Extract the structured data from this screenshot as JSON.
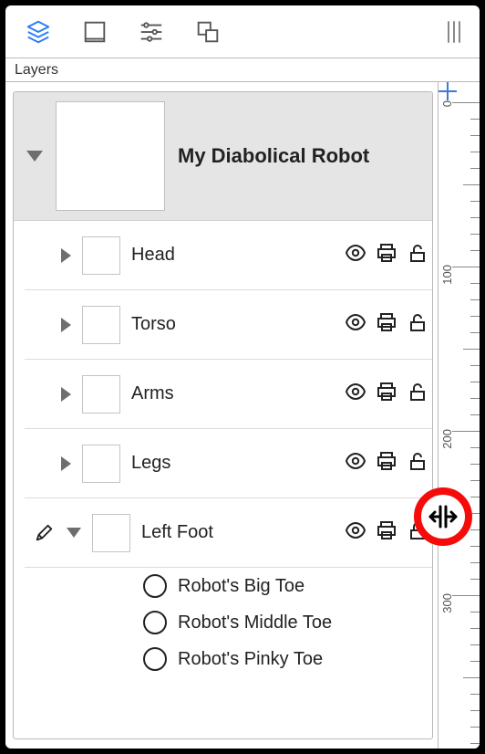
{
  "panelTitle": "Layers",
  "root": {
    "name": "My Diabolical Robot"
  },
  "children": [
    {
      "name": "Head",
      "editing": false,
      "expanded": false
    },
    {
      "name": "Torso",
      "editing": false,
      "expanded": false
    },
    {
      "name": "Arms",
      "editing": false,
      "expanded": false
    },
    {
      "name": "Legs",
      "editing": false,
      "expanded": false
    },
    {
      "name": "Left Foot",
      "editing": true,
      "expanded": true,
      "items": [
        {
          "name": "Robot's Big Toe"
        },
        {
          "name": "Robot's Middle Toe"
        },
        {
          "name": "Robot's Pinky Toe"
        }
      ]
    }
  ],
  "rulerLabels": [
    "0",
    "100",
    "200",
    "300"
  ]
}
